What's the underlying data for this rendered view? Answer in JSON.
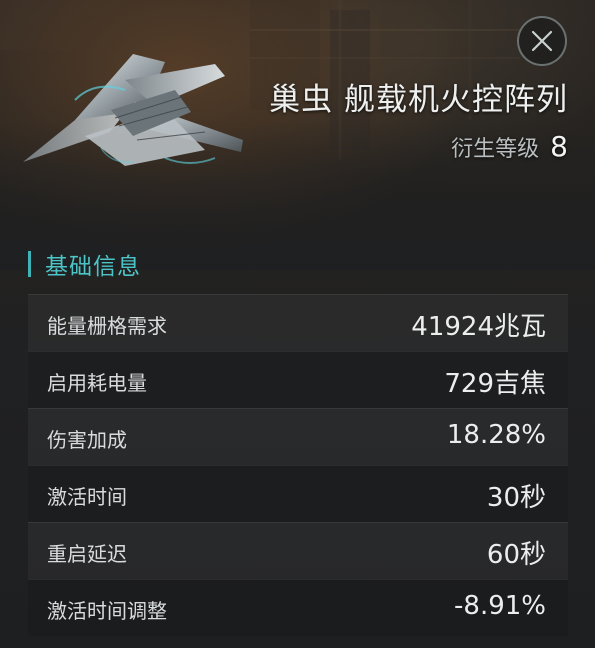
{
  "item": {
    "title": "巢虫 舰载机火控阵列",
    "tier_label": "衍生等级",
    "tier_value": "8",
    "icon": "ship-thumbnail"
  },
  "close_icon": "close-icon",
  "section": {
    "title": "基础信息"
  },
  "stats": [
    {
      "label": "能量栅格需求",
      "value": "41924兆瓦"
    },
    {
      "label": "启用耗电量",
      "value": "729吉焦"
    },
    {
      "label": "伤害加成",
      "value": "18.28%"
    },
    {
      "label": "激活时间",
      "value": "30秒"
    },
    {
      "label": "重启延迟",
      "value": "60秒"
    },
    {
      "label": "激活时间调整",
      "value": "-8.91%"
    }
  ],
  "colors": {
    "accent": "#4cc4c8",
    "text": "#eceeee",
    "background": "#1e1f21"
  }
}
